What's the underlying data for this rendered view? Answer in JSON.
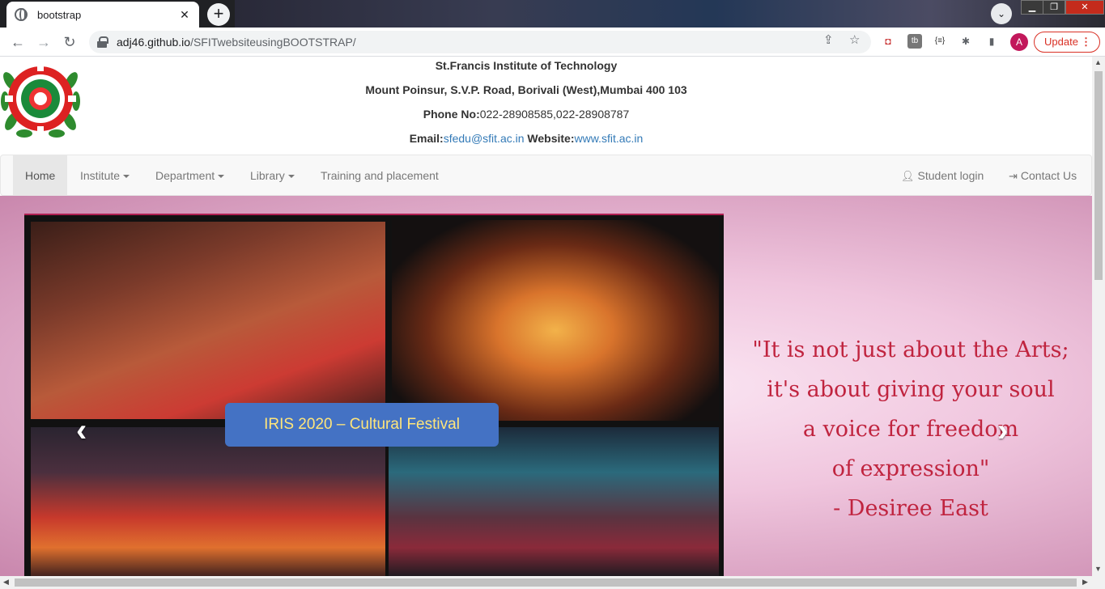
{
  "browser": {
    "tab_title": "bootstrap",
    "tab_close": "✕",
    "new_tab": "+",
    "url_host": "adj46.github.io",
    "url_path": "/SFITwebsiteusingBOOTSTRAP/",
    "avatar_letter": "A",
    "update_label": "Update",
    "update_menu": "⋮",
    "icons": [
      "back-icon",
      "forward-icon",
      "reload-icon",
      "lock-icon",
      "share-icon",
      "star-icon",
      "extension-icon",
      "puzzle-icon",
      "sidepanel-icon"
    ]
  },
  "header": {
    "institute": "St.Francis Institute of Technology",
    "address": "Mount Poinsur, S.V.P. Road, Borivali (West),Mumbai 400 103",
    "phone_label": "Phone No:",
    "phone_value": "022-28908585,022-28908787",
    "email_label": "Email:",
    "email_value": "sfedu@sfit.ac.in",
    "website_label": " Website:",
    "website_value": "www.sfit.ac.in"
  },
  "nav": {
    "home": "Home",
    "institute": "Institute",
    "department": "Department",
    "library": "Library",
    "training": "Training and placement",
    "student_login": "Student login",
    "contact": "Contact Us"
  },
  "carousel": {
    "caption": "IRIS 2020 – Cultural Festival",
    "quote_lines": [
      "\"It is not just about the Arts;",
      "it's about giving your soul",
      "a voice for freedom",
      "of expression\"",
      "- Desiree East"
    ],
    "prev": "‹",
    "next": "›"
  },
  "colors": {
    "link": "#337ab7",
    "quote": "#c0243f",
    "caption_bg": "#4472c4",
    "caption_text": "#ffe57a"
  }
}
